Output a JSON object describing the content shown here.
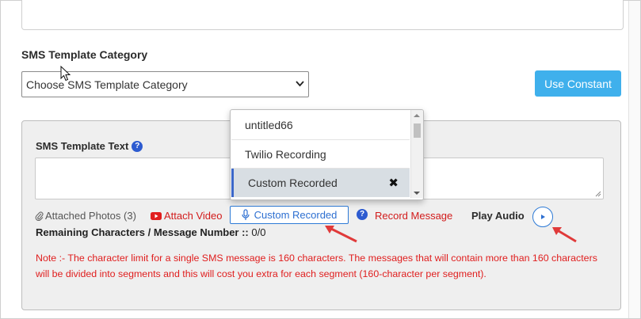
{
  "category": {
    "label": "SMS Template Category",
    "select_value": "Choose SMS Template Category"
  },
  "use_constant_label": "Use Constant",
  "template": {
    "label": "SMS Template Text",
    "text_value": ""
  },
  "dropdown": {
    "items": [
      {
        "label": "untitled66"
      },
      {
        "label": "Twilio Recording"
      },
      {
        "label": "Custom Recorded"
      }
    ],
    "selected_index": 2
  },
  "toolbar": {
    "attached_photos": "Attached Photos (3)",
    "attach_video": "Attach Video",
    "custom_recorded": "Custom Recorded",
    "record_message": "Record Message",
    "play_audio": "Play Audio"
  },
  "remaining": {
    "label": "Remaining Characters / Message Number ::",
    "value": "0/0"
  },
  "note": "Note :- The character limit for a single SMS message is 160 characters. The messages that will contain more than 160 characters will be divided into segments and this will cost you extra for each segment (160-character per segment).",
  "colors": {
    "accent_button": "#3fb0ec",
    "link_red": "#d21b1b",
    "link_blue": "#2d6fd1",
    "annotation_arrow": "#e03a3a"
  }
}
